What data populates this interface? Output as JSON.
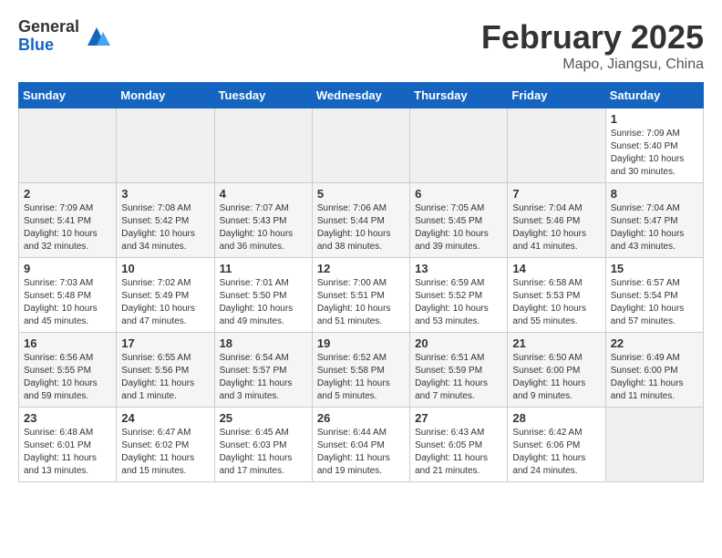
{
  "header": {
    "logo_general": "General",
    "logo_blue": "Blue",
    "title": "February 2025",
    "subtitle": "Mapo, Jiangsu, China"
  },
  "weekdays": [
    "Sunday",
    "Monday",
    "Tuesday",
    "Wednesday",
    "Thursday",
    "Friday",
    "Saturday"
  ],
  "weeks": [
    [
      {
        "day": "",
        "info": ""
      },
      {
        "day": "",
        "info": ""
      },
      {
        "day": "",
        "info": ""
      },
      {
        "day": "",
        "info": ""
      },
      {
        "day": "",
        "info": ""
      },
      {
        "day": "",
        "info": ""
      },
      {
        "day": "1",
        "info": "Sunrise: 7:09 AM\nSunset: 5:40 PM\nDaylight: 10 hours and 30 minutes."
      }
    ],
    [
      {
        "day": "2",
        "info": "Sunrise: 7:09 AM\nSunset: 5:41 PM\nDaylight: 10 hours and 32 minutes."
      },
      {
        "day": "3",
        "info": "Sunrise: 7:08 AM\nSunset: 5:42 PM\nDaylight: 10 hours and 34 minutes."
      },
      {
        "day": "4",
        "info": "Sunrise: 7:07 AM\nSunset: 5:43 PM\nDaylight: 10 hours and 36 minutes."
      },
      {
        "day": "5",
        "info": "Sunrise: 7:06 AM\nSunset: 5:44 PM\nDaylight: 10 hours and 38 minutes."
      },
      {
        "day": "6",
        "info": "Sunrise: 7:05 AM\nSunset: 5:45 PM\nDaylight: 10 hours and 39 minutes."
      },
      {
        "day": "7",
        "info": "Sunrise: 7:04 AM\nSunset: 5:46 PM\nDaylight: 10 hours and 41 minutes."
      },
      {
        "day": "8",
        "info": "Sunrise: 7:04 AM\nSunset: 5:47 PM\nDaylight: 10 hours and 43 minutes."
      }
    ],
    [
      {
        "day": "9",
        "info": "Sunrise: 7:03 AM\nSunset: 5:48 PM\nDaylight: 10 hours and 45 minutes."
      },
      {
        "day": "10",
        "info": "Sunrise: 7:02 AM\nSunset: 5:49 PM\nDaylight: 10 hours and 47 minutes."
      },
      {
        "day": "11",
        "info": "Sunrise: 7:01 AM\nSunset: 5:50 PM\nDaylight: 10 hours and 49 minutes."
      },
      {
        "day": "12",
        "info": "Sunrise: 7:00 AM\nSunset: 5:51 PM\nDaylight: 10 hours and 51 minutes."
      },
      {
        "day": "13",
        "info": "Sunrise: 6:59 AM\nSunset: 5:52 PM\nDaylight: 10 hours and 53 minutes."
      },
      {
        "day": "14",
        "info": "Sunrise: 6:58 AM\nSunset: 5:53 PM\nDaylight: 10 hours and 55 minutes."
      },
      {
        "day": "15",
        "info": "Sunrise: 6:57 AM\nSunset: 5:54 PM\nDaylight: 10 hours and 57 minutes."
      }
    ],
    [
      {
        "day": "16",
        "info": "Sunrise: 6:56 AM\nSunset: 5:55 PM\nDaylight: 10 hours and 59 minutes."
      },
      {
        "day": "17",
        "info": "Sunrise: 6:55 AM\nSunset: 5:56 PM\nDaylight: 11 hours and 1 minute."
      },
      {
        "day": "18",
        "info": "Sunrise: 6:54 AM\nSunset: 5:57 PM\nDaylight: 11 hours and 3 minutes."
      },
      {
        "day": "19",
        "info": "Sunrise: 6:52 AM\nSunset: 5:58 PM\nDaylight: 11 hours and 5 minutes."
      },
      {
        "day": "20",
        "info": "Sunrise: 6:51 AM\nSunset: 5:59 PM\nDaylight: 11 hours and 7 minutes."
      },
      {
        "day": "21",
        "info": "Sunrise: 6:50 AM\nSunset: 6:00 PM\nDaylight: 11 hours and 9 minutes."
      },
      {
        "day": "22",
        "info": "Sunrise: 6:49 AM\nSunset: 6:00 PM\nDaylight: 11 hours and 11 minutes."
      }
    ],
    [
      {
        "day": "23",
        "info": "Sunrise: 6:48 AM\nSunset: 6:01 PM\nDaylight: 11 hours and 13 minutes."
      },
      {
        "day": "24",
        "info": "Sunrise: 6:47 AM\nSunset: 6:02 PM\nDaylight: 11 hours and 15 minutes."
      },
      {
        "day": "25",
        "info": "Sunrise: 6:45 AM\nSunset: 6:03 PM\nDaylight: 11 hours and 17 minutes."
      },
      {
        "day": "26",
        "info": "Sunrise: 6:44 AM\nSunset: 6:04 PM\nDaylight: 11 hours and 19 minutes."
      },
      {
        "day": "27",
        "info": "Sunrise: 6:43 AM\nSunset: 6:05 PM\nDaylight: 11 hours and 21 minutes."
      },
      {
        "day": "28",
        "info": "Sunrise: 6:42 AM\nSunset: 6:06 PM\nDaylight: 11 hours and 24 minutes."
      },
      {
        "day": "",
        "info": ""
      }
    ]
  ]
}
